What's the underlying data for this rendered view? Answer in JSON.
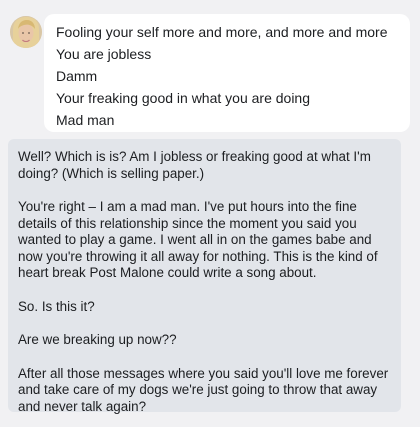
{
  "conversation": {
    "incoming": {
      "lines": [
        "Fooling your self more and more, and more and more",
        "You are jobless",
        "Damm",
        "Your freaking good in what you are doing",
        "Mad man"
      ]
    },
    "outgoing": {
      "paragraphs": [
        "Well? Which is is? Am I jobless or freaking good at what I'm doing? (Which is selling paper.)",
        "You're right – I am a mad man. I've put hours into the fine details of this relationship since the moment you said you wanted to play a game. I went all in on the games babe and now you're throwing it all away for nothing. This is the kind of heart break Post Malone could write a song about.",
        "So. Is this it?",
        "Are we breaking up now??",
        "After all those messages where you said you'll love me forever and take care of my dogs we're just going to throw that away and never talk again?"
      ]
    }
  }
}
